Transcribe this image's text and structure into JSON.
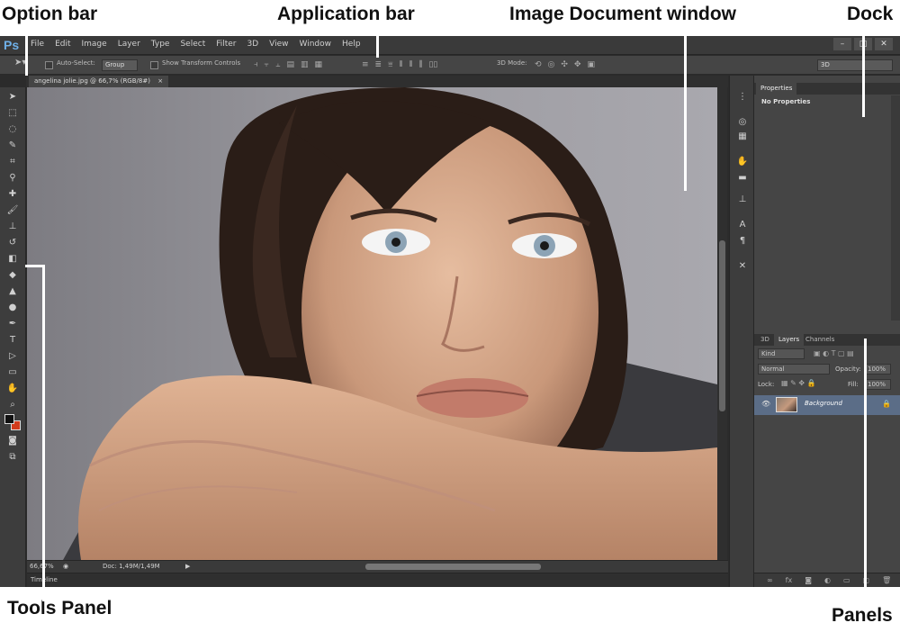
{
  "annotations": {
    "option_bar": "Option bar",
    "application_bar": "Application bar",
    "image_document_window": "Image Document window",
    "dock": "Dock",
    "tools_panel": "Tools Panel",
    "panels": "Panels"
  },
  "app": {
    "logo": "Ps",
    "menu": [
      "File",
      "Edit",
      "Image",
      "Layer",
      "Type",
      "Select",
      "Filter",
      "3D",
      "View",
      "Window",
      "Help"
    ],
    "window_controls": [
      "–",
      "□",
      "✕"
    ]
  },
  "options": {
    "auto_select_label": "Auto-Select:",
    "auto_select_value": "Group",
    "show_transform_label": "Show Transform Controls",
    "mode_3d_label": "3D Mode:",
    "workspace_value": "3D"
  },
  "document": {
    "tab_title": "angelina jolie.jpg @ 66,7% (RGB/8#)",
    "zoom": "66,67%",
    "doc_size": "Doc: 1,49M/1,49M"
  },
  "timeline": {
    "label": "Timeline"
  },
  "properties": {
    "tab": "Properties",
    "empty_text": "No Properties"
  },
  "layers": {
    "tabs": [
      "3D",
      "Layers",
      "Channels"
    ],
    "kind_filter": "Kind",
    "blend_mode": "Normal",
    "opacity_label": "Opacity:",
    "opacity_value": "100%",
    "lock_label": "Lock:",
    "fill_label": "Fill:",
    "fill_value": "100%",
    "layer_name": "Background"
  },
  "colors": {
    "foreground": "#111111",
    "background": "#d23b1c",
    "selected_layer": "#5b6d87",
    "logo": "#6fb0e8"
  }
}
